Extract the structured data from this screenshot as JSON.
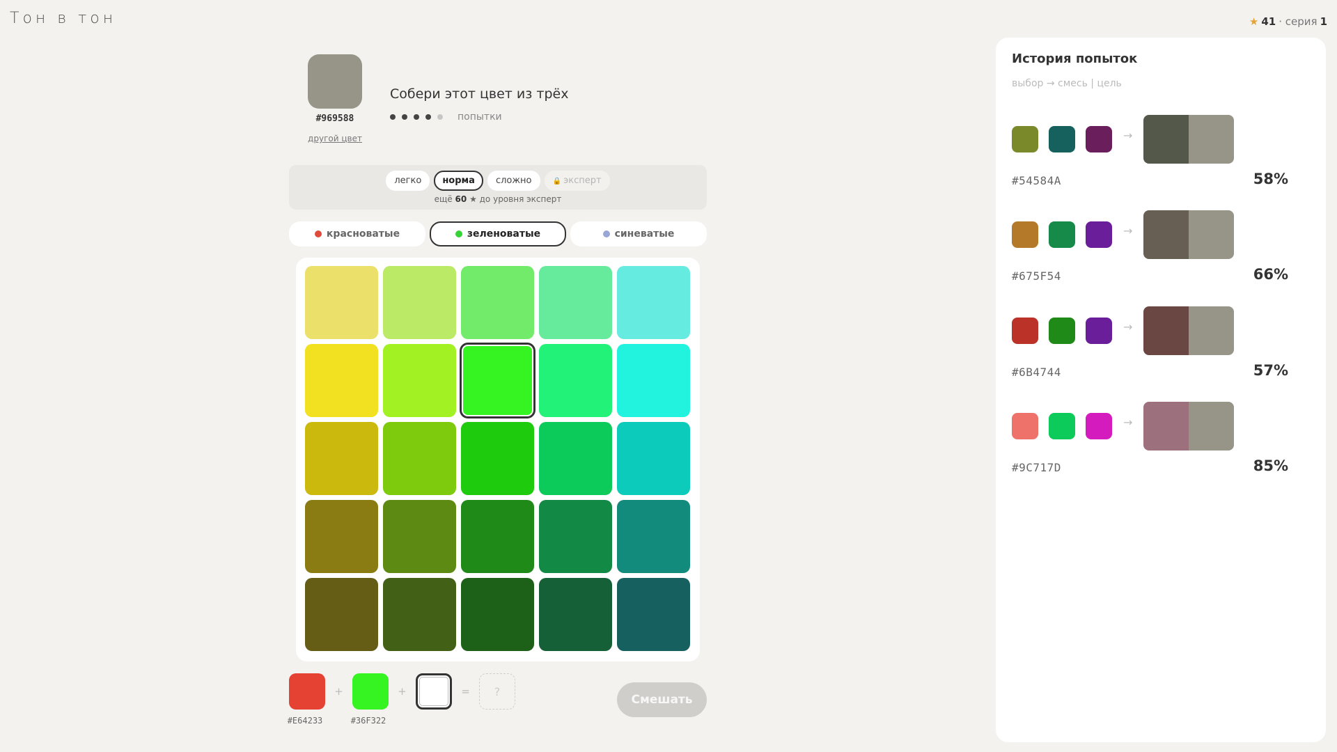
{
  "app": {
    "title": "Тон в тон",
    "stars": "41",
    "series_label": "· серия",
    "series": "1"
  },
  "target": {
    "hex": "#969588",
    "color": "#969588",
    "other_link": "другой цвет"
  },
  "task": {
    "heading": "Собери этот цвет из трёх",
    "attempts_label": "попытки",
    "attempts_total": 5,
    "attempts_used": 4
  },
  "difficulty": {
    "levels": [
      {
        "label": "легко",
        "state": "normal"
      },
      {
        "label": "норма",
        "state": "active"
      },
      {
        "label": "сложно",
        "state": "normal"
      },
      {
        "label": "эксперт",
        "state": "locked",
        "icon": "lock-icon"
      }
    ],
    "note_prefix": "ещё",
    "note_value": "60",
    "note_suffix": "★ до уровня эксперт"
  },
  "tints": [
    {
      "label": "красноватые",
      "dot": "#e04a3a",
      "active": false
    },
    {
      "label": "зеленоватые",
      "dot": "#36d336",
      "active": true
    },
    {
      "label": "синеватые",
      "dot": "#9aa6d6",
      "active": false
    }
  ],
  "palette": [
    [
      "#ebe16a",
      "#bbeb66",
      "#72eb6a",
      "#66eb9d",
      "#66ebe0"
    ],
    [
      "#f2e121",
      "#a2f223",
      "#36f322",
      "#22f378",
      "#22f3df"
    ],
    [
      "#cbb90d",
      "#7ecb0d",
      "#1ecb0d",
      "#0dcb5a",
      "#0dcbba"
    ],
    [
      "#8a7c12",
      "#5c8a12",
      "#1f8a17",
      "#128a45",
      "#128a7c"
    ],
    [
      "#655c16",
      "#426016",
      "#1d6017",
      "#166038",
      "#166060"
    ]
  ],
  "selected_cell": "1-2",
  "mix": {
    "slots": [
      {
        "color": "#e64233",
        "hex": "#E64233"
      },
      {
        "color": "#36f322",
        "hex": "#36F322"
      },
      {
        "color": "",
        "hex": ""
      }
    ],
    "plus": "+",
    "equals": "=",
    "result_placeholder": "?",
    "button": "Смешать"
  },
  "history": {
    "title": "История попыток",
    "legend": "выбор → смесь | цель",
    "arrow": "→",
    "entries": [
      {
        "picks": [
          "#7a8a2a",
          "#16605e",
          "#6a1e5c"
        ],
        "mix": "#54584a",
        "target": "#969588",
        "hex": "#54584A",
        "score": "58%"
      },
      {
        "picks": [
          "#b47a2a",
          "#168a48",
          "#6a1e9a"
        ],
        "mix": "#675f54",
        "target": "#969588",
        "hex": "#675F54",
        "score": "66%"
      },
      {
        "picks": [
          "#bb3328",
          "#1f8a17",
          "#6a1e9a"
        ],
        "mix": "#6b4744",
        "target": "#969588",
        "hex": "#6B4744",
        "score": "57%"
      },
      {
        "picks": [
          "#ee7269",
          "#0dcb5a",
          "#d41cbe"
        ],
        "mix": "#9c717d",
        "target": "#969588",
        "hex": "#9C717D",
        "score": "85%"
      }
    ]
  }
}
